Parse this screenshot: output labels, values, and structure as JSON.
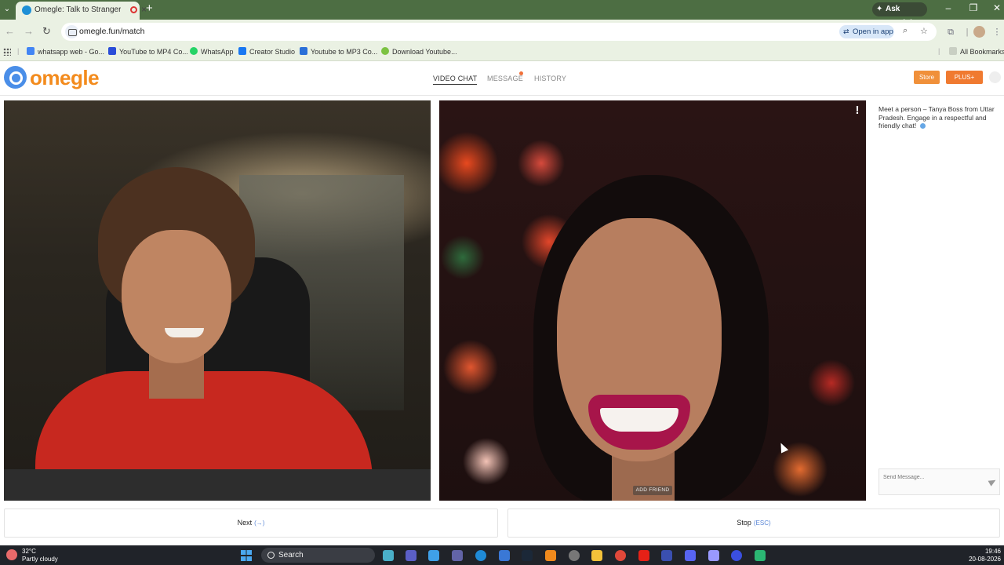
{
  "browser": {
    "tab_title": "Omegle: Talk to Strangers!",
    "new_tab": "+",
    "ask_gemini": "Ask Gemini",
    "url": "omegle.fun/match",
    "open_in_app": "Open in app",
    "bookmarks": [
      {
        "label": "whatsapp web - Go...",
        "color": "#4285f4"
      },
      {
        "label": "YouTube to MP4 Co...",
        "color": "#2a4dd8"
      },
      {
        "label": "WhatsApp",
        "color": "#25d366"
      },
      {
        "label": "Creator Studio",
        "color": "#1877f2"
      },
      {
        "label": "Youtube to MP3 Co...",
        "color": "#2a6fd8"
      },
      {
        "label": "Download Youtube...",
        "color": "#7cc242"
      }
    ],
    "all_bookmarks": "All Bookmarks"
  },
  "site": {
    "logo": "omegle",
    "nav": [
      {
        "label": "VIDEO CHAT",
        "active": true
      },
      {
        "label": "MESSAGE",
        "active": false
      },
      {
        "label": "HISTORY",
        "active": false
      }
    ],
    "store": "Store",
    "plus": "PLUS+"
  },
  "video": {
    "add_friend": "ADD FRIEND",
    "report": "!"
  },
  "chat": {
    "intro_message": "Meet a person – Tanya Boss from Uttar Pradesh. Engage in a respectful and friendly chat!",
    "input_placeholder": "Send Message..."
  },
  "controls": {
    "next_label": "Next",
    "next_hint": "(→)",
    "stop_label": "Stop",
    "stop_hint": "(ESC)"
  },
  "taskbar": {
    "temperature": "32°C",
    "weather": "Partly cloudy",
    "search": "Search",
    "time": "19:46",
    "date": "20-08-2026"
  }
}
